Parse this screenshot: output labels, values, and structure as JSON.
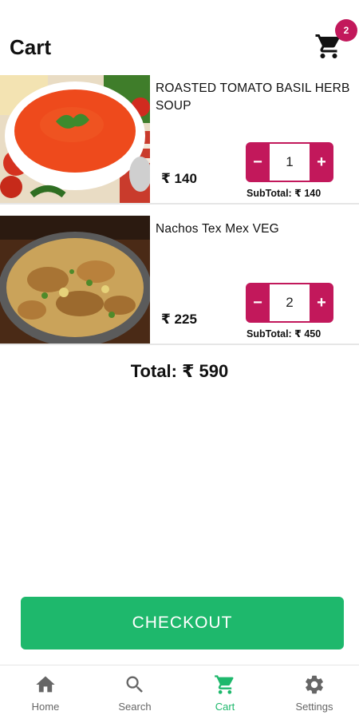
{
  "header": {
    "title": "Cart",
    "cart_badge": "2"
  },
  "items": [
    {
      "name": "ROASTED TOMATO BASIL HERB SOUP",
      "price": "₹ 140",
      "quantity": "1",
      "minus": "−",
      "plus": "+",
      "subtotal": "SubTotal: ₹ 140"
    },
    {
      "name": "Nachos Tex Mex VEG",
      "price": "₹ 225",
      "quantity": "2",
      "minus": "−",
      "plus": "+",
      "subtotal": "SubTotal: ₹ 450"
    }
  ],
  "total": "Total: ₹ 590",
  "checkout_label": "CHECKOUT",
  "tabs": [
    {
      "label": "Home",
      "icon": "home-icon"
    },
    {
      "label": "Search",
      "icon": "search-icon"
    },
    {
      "label": "Cart",
      "icon": "cart-icon",
      "active": true
    },
    {
      "label": "Settings",
      "icon": "gear-icon"
    }
  ],
  "colors": {
    "accent": "#c2185b",
    "primary_green": "#1eb86c",
    "inactive_tab": "#666666"
  }
}
